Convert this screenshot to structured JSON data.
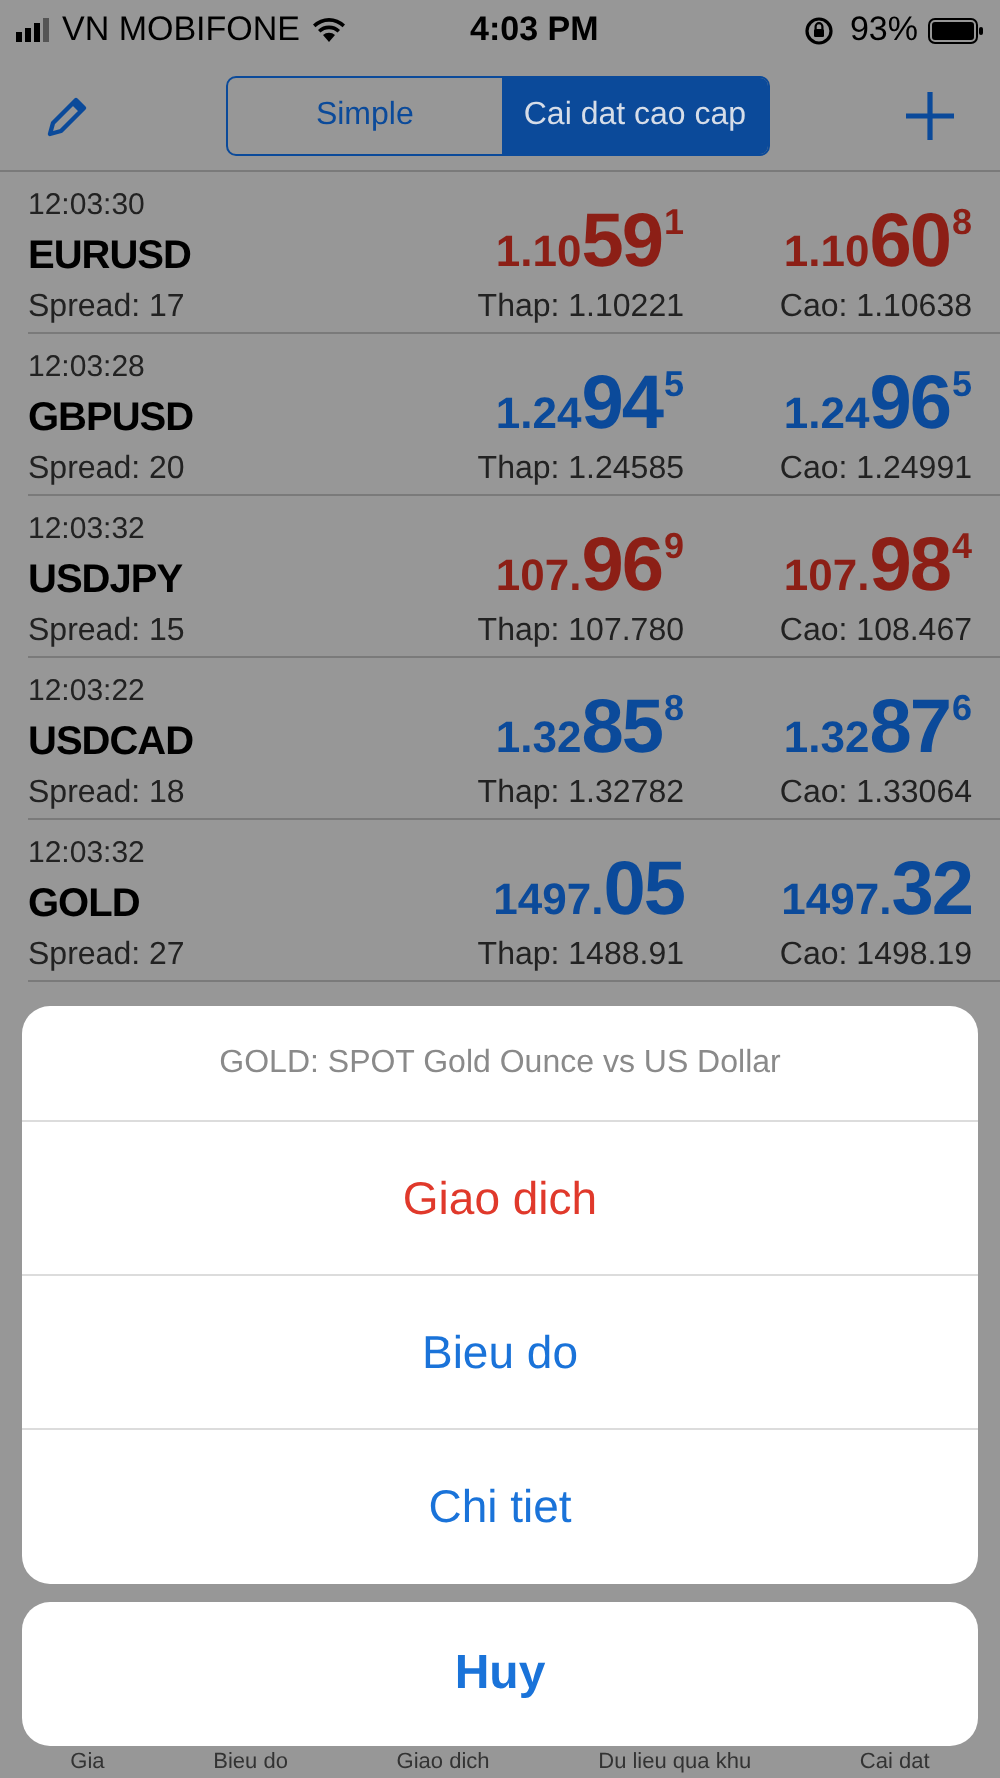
{
  "status_bar": {
    "carrier": "VN MOBIFONE",
    "time": "4:03 PM",
    "battery": "93%"
  },
  "nav": {
    "segments": [
      {
        "label": "Simple",
        "selected": false
      },
      {
        "label": "Cai dat cao cap",
        "selected": true
      }
    ]
  },
  "quotes": [
    {
      "time": "12:03:30",
      "symbol": "EURUSD",
      "spread": "Spread: 17",
      "color": "#8c1f16",
      "bid": {
        "prefix": "1.10",
        "big": "59",
        "sup": "1"
      },
      "ask": {
        "prefix": "1.10",
        "big": "60",
        "sup": "8"
      },
      "low": "Thap: 1.10221",
      "high": "Cao: 1.10638"
    },
    {
      "time": "12:03:28",
      "symbol": "GBPUSD",
      "spread": "Spread: 20",
      "color": "#0b4a9a",
      "bid": {
        "prefix": "1.24",
        "big": "94",
        "sup": "5"
      },
      "ask": {
        "prefix": "1.24",
        "big": "96",
        "sup": "5"
      },
      "low": "Thap: 1.24585",
      "high": "Cao: 1.24991"
    },
    {
      "time": "12:03:32",
      "symbol": "USDJPY",
      "spread": "Spread: 15",
      "color": "#8c1f16",
      "bid": {
        "prefix": "107.",
        "big": "96",
        "sup": "9"
      },
      "ask": {
        "prefix": "107.",
        "big": "98",
        "sup": "4"
      },
      "low": "Thap: 107.780",
      "high": "Cao: 108.467"
    },
    {
      "time": "12:03:22",
      "symbol": "USDCAD",
      "spread": "Spread: 18",
      "color": "#0b4a9a",
      "bid": {
        "prefix": "1.32",
        "big": "85",
        "sup": "8"
      },
      "ask": {
        "prefix": "1.32",
        "big": "87",
        "sup": "6"
      },
      "low": "Thap: 1.32782",
      "high": "Cao: 1.33064"
    },
    {
      "time": "12:03:32",
      "symbol": "GOLD",
      "spread": "Spread: 27",
      "color": "#0b4a9a",
      "bid": {
        "prefix": "1497.",
        "big": "05"
      },
      "ask": {
        "prefix": "1497.",
        "big": "32"
      },
      "low": "Thap: 1488.91",
      "high": "Cao: 1498.19"
    }
  ],
  "action_sheet": {
    "title": "GOLD: SPOT Gold Ounce vs US Dollar",
    "actions": [
      {
        "label": "Giao dich",
        "kind": "destructive"
      },
      {
        "label": "Bieu do",
        "kind": "default"
      },
      {
        "label": "Chi tiet",
        "kind": "default"
      }
    ],
    "cancel": "Huy"
  },
  "tab_bar": [
    {
      "label": "Gia"
    },
    {
      "label": "Bieu do"
    },
    {
      "label": "Giao dich"
    },
    {
      "label": "Du lieu qua khu"
    },
    {
      "label": "Cai dat"
    }
  ]
}
